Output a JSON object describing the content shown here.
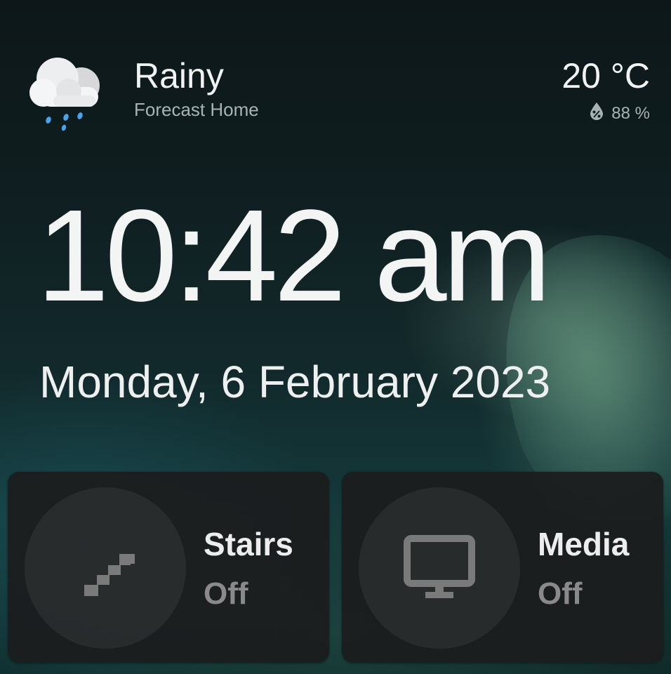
{
  "weather": {
    "icon": "rainy-cloud-icon",
    "condition": "Rainy",
    "location": "Forecast Home",
    "temperature": "20 °C",
    "humidity_icon": "water-percent-icon",
    "humidity": "88 %"
  },
  "clock": {
    "time": "10:42 am",
    "date": "Monday, 6 February 2023"
  },
  "tiles": [
    {
      "name": "Stairs",
      "state": "Off",
      "icon": "stairs-icon"
    },
    {
      "name": "Media",
      "state": "Off",
      "icon": "monitor-icon"
    }
  ],
  "colors": {
    "primary_text": "#f1f3f3",
    "secondary_text": "#a9b3b4",
    "tile_background": "#1c1d1e",
    "icon_off": "#7a7a7a",
    "rain_drop": "#4aa3e8"
  }
}
